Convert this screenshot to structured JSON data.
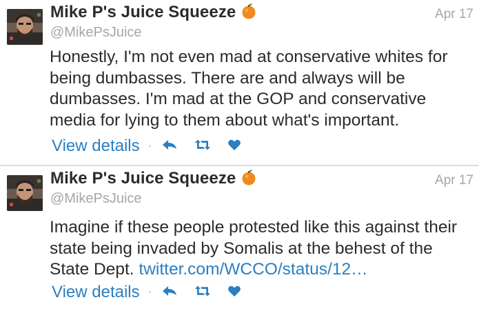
{
  "tweets": [
    {
      "author_name": "Mike P's Juice Squeeze",
      "handle": "@MikePsJuice",
      "date": "Apr 17",
      "text": "Honestly, I'm not even mad at conservative whites for being dumbasses. There are and always will be dumbasses. I'm mad at the GOP and conservative media for lying to them about what's important.",
      "link": "",
      "view_details": "View details",
      "separator": "·",
      "icons": [
        "avatar",
        "orange-icon",
        "reply-icon",
        "retweet-icon",
        "favorite-icon"
      ]
    },
    {
      "author_name": "Mike P's Juice Squeeze",
      "handle": "@MikePsJuice",
      "date": "Apr 17",
      "text": "Imagine if these people protested like this against their state being invaded by Somalis at the behest of the State Dept. ",
      "link": "twitter.com/WCCO/status/12…",
      "view_details": "View details",
      "separator": "·",
      "icons": [
        "avatar",
        "orange-icon",
        "reply-icon",
        "retweet-icon",
        "favorite-icon"
      ]
    }
  ],
  "colors": {
    "link": "#2a7fc1",
    "text": "#2b2b2b",
    "meta": "#a6a6a6",
    "divider": "#dcdcdc",
    "orange": "#f08a1c"
  }
}
